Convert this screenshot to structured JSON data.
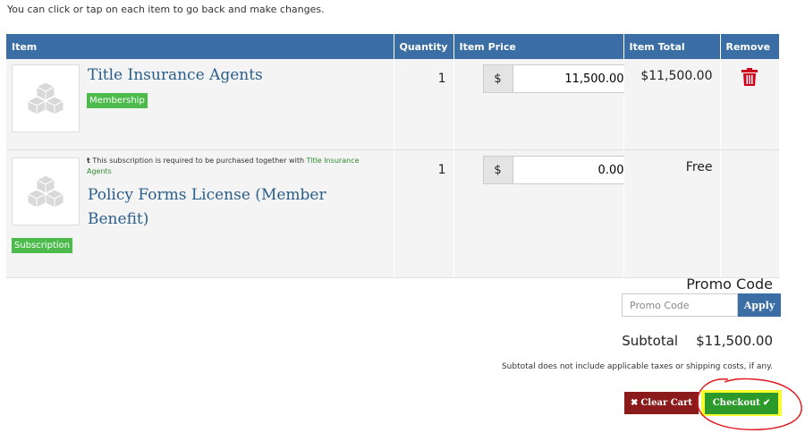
{
  "intro_text": "You can click or tap on each item to go back and make changes.",
  "table": {
    "headers": [
      "Item",
      "Quantity",
      "Item Price",
      "Item Total",
      "Remove"
    ],
    "rows": [
      {
        "name": "Title Insurance Agents",
        "badge": "Membership",
        "quantity": "1",
        "currency": "$",
        "price": "11,500.00",
        "total": "$11,500.00"
      },
      {
        "required_prefix": "t",
        "required_text": "This subscription is required to be purchased together with",
        "required_link": "Title Insurance Agents",
        "name": "Policy Forms License (Member Benefit)",
        "badge": "Subscription",
        "quantity": "1",
        "currency": "$",
        "price": "0.00",
        "total": "Free"
      }
    ]
  },
  "promo": {
    "title": "Promo Code",
    "placeholder": "Promo Code",
    "apply_label": "Apply"
  },
  "subtotal": {
    "label": "Subtotal",
    "value": "$11,500.00",
    "note": "Subtotal does not include applicable taxes or shipping costs, if any."
  },
  "buttons": {
    "clear_label": "Clear Cart",
    "checkout_label": "Checkout"
  },
  "colors": {
    "header_blue": "#3a6ea5",
    "badge_green": "#4cbb4c",
    "clear_red": "#8b1a1a",
    "checkout_green": "#2b9a2b",
    "highlight_yellow": "#f7ff2c",
    "trash_red": "#d0021b"
  }
}
